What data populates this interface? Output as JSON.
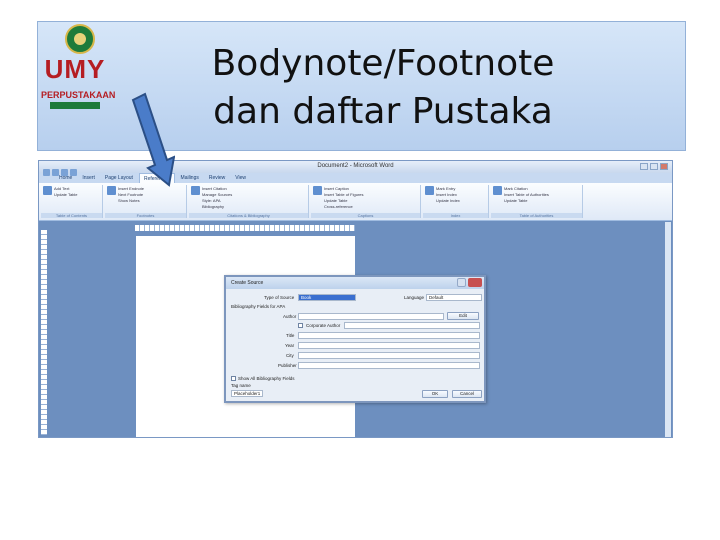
{
  "slide": {
    "title_line1": "Bodynote/Footnote",
    "title_line2": "dan daftar Pustaka",
    "logo_text": "UMY",
    "logo_subtext": "PERPUSTAKAAN"
  },
  "colors": {
    "arrow_fill": "#4a7cc9",
    "arrow_stroke": "#2b4f86",
    "logo_red": "#b51d22",
    "logo_green": "#1e7b3a"
  },
  "word": {
    "window_title": "Document2 - Microsoft Word",
    "tabs": [
      "Home",
      "Insert",
      "Page Layout",
      "References",
      "Mailings",
      "Review",
      "View"
    ],
    "active_tab": "References",
    "ribbon_groups": [
      {
        "name": "Table of Contents",
        "items": [
          "Add Text",
          "Update Table"
        ]
      },
      {
        "name": "Footnotes",
        "items": [
          "Insert Endnote",
          "Next Footnote",
          "Show Notes"
        ]
      },
      {
        "name": "Citations & Bibliography",
        "items": [
          "Insert Citation",
          "Manage Sources",
          "Style: APA",
          "Bibliography"
        ]
      },
      {
        "name": "Captions",
        "items": [
          "Insert Caption",
          "Insert Table of Figures",
          "Update Table",
          "Cross-reference"
        ]
      },
      {
        "name": "Index",
        "items": [
          "Mark Entry",
          "Insert Index",
          "Update Index"
        ]
      },
      {
        "name": "Table of Authorities",
        "items": [
          "Mark Citation",
          "Insert Table of Authorities",
          "Update Table"
        ]
      }
    ]
  },
  "dialog": {
    "title": "Create Source",
    "type_label": "Type of Source",
    "type_value": "Book",
    "language_label": "Language",
    "language_value": "Default",
    "fields_header": "Bibliography Fields for APA",
    "author_label": "Author",
    "edit_button": "Edit",
    "corporate_label": "Corporate Author",
    "title_label": "Title",
    "year_label": "Year",
    "city_label": "City",
    "publisher_label": "Publisher",
    "show_all_label": "Show All Bibliography Fields",
    "tag_label": "Tag name",
    "tag_value": "Placeholder1",
    "ok_button": "OK",
    "cancel_button": "Cancel"
  }
}
